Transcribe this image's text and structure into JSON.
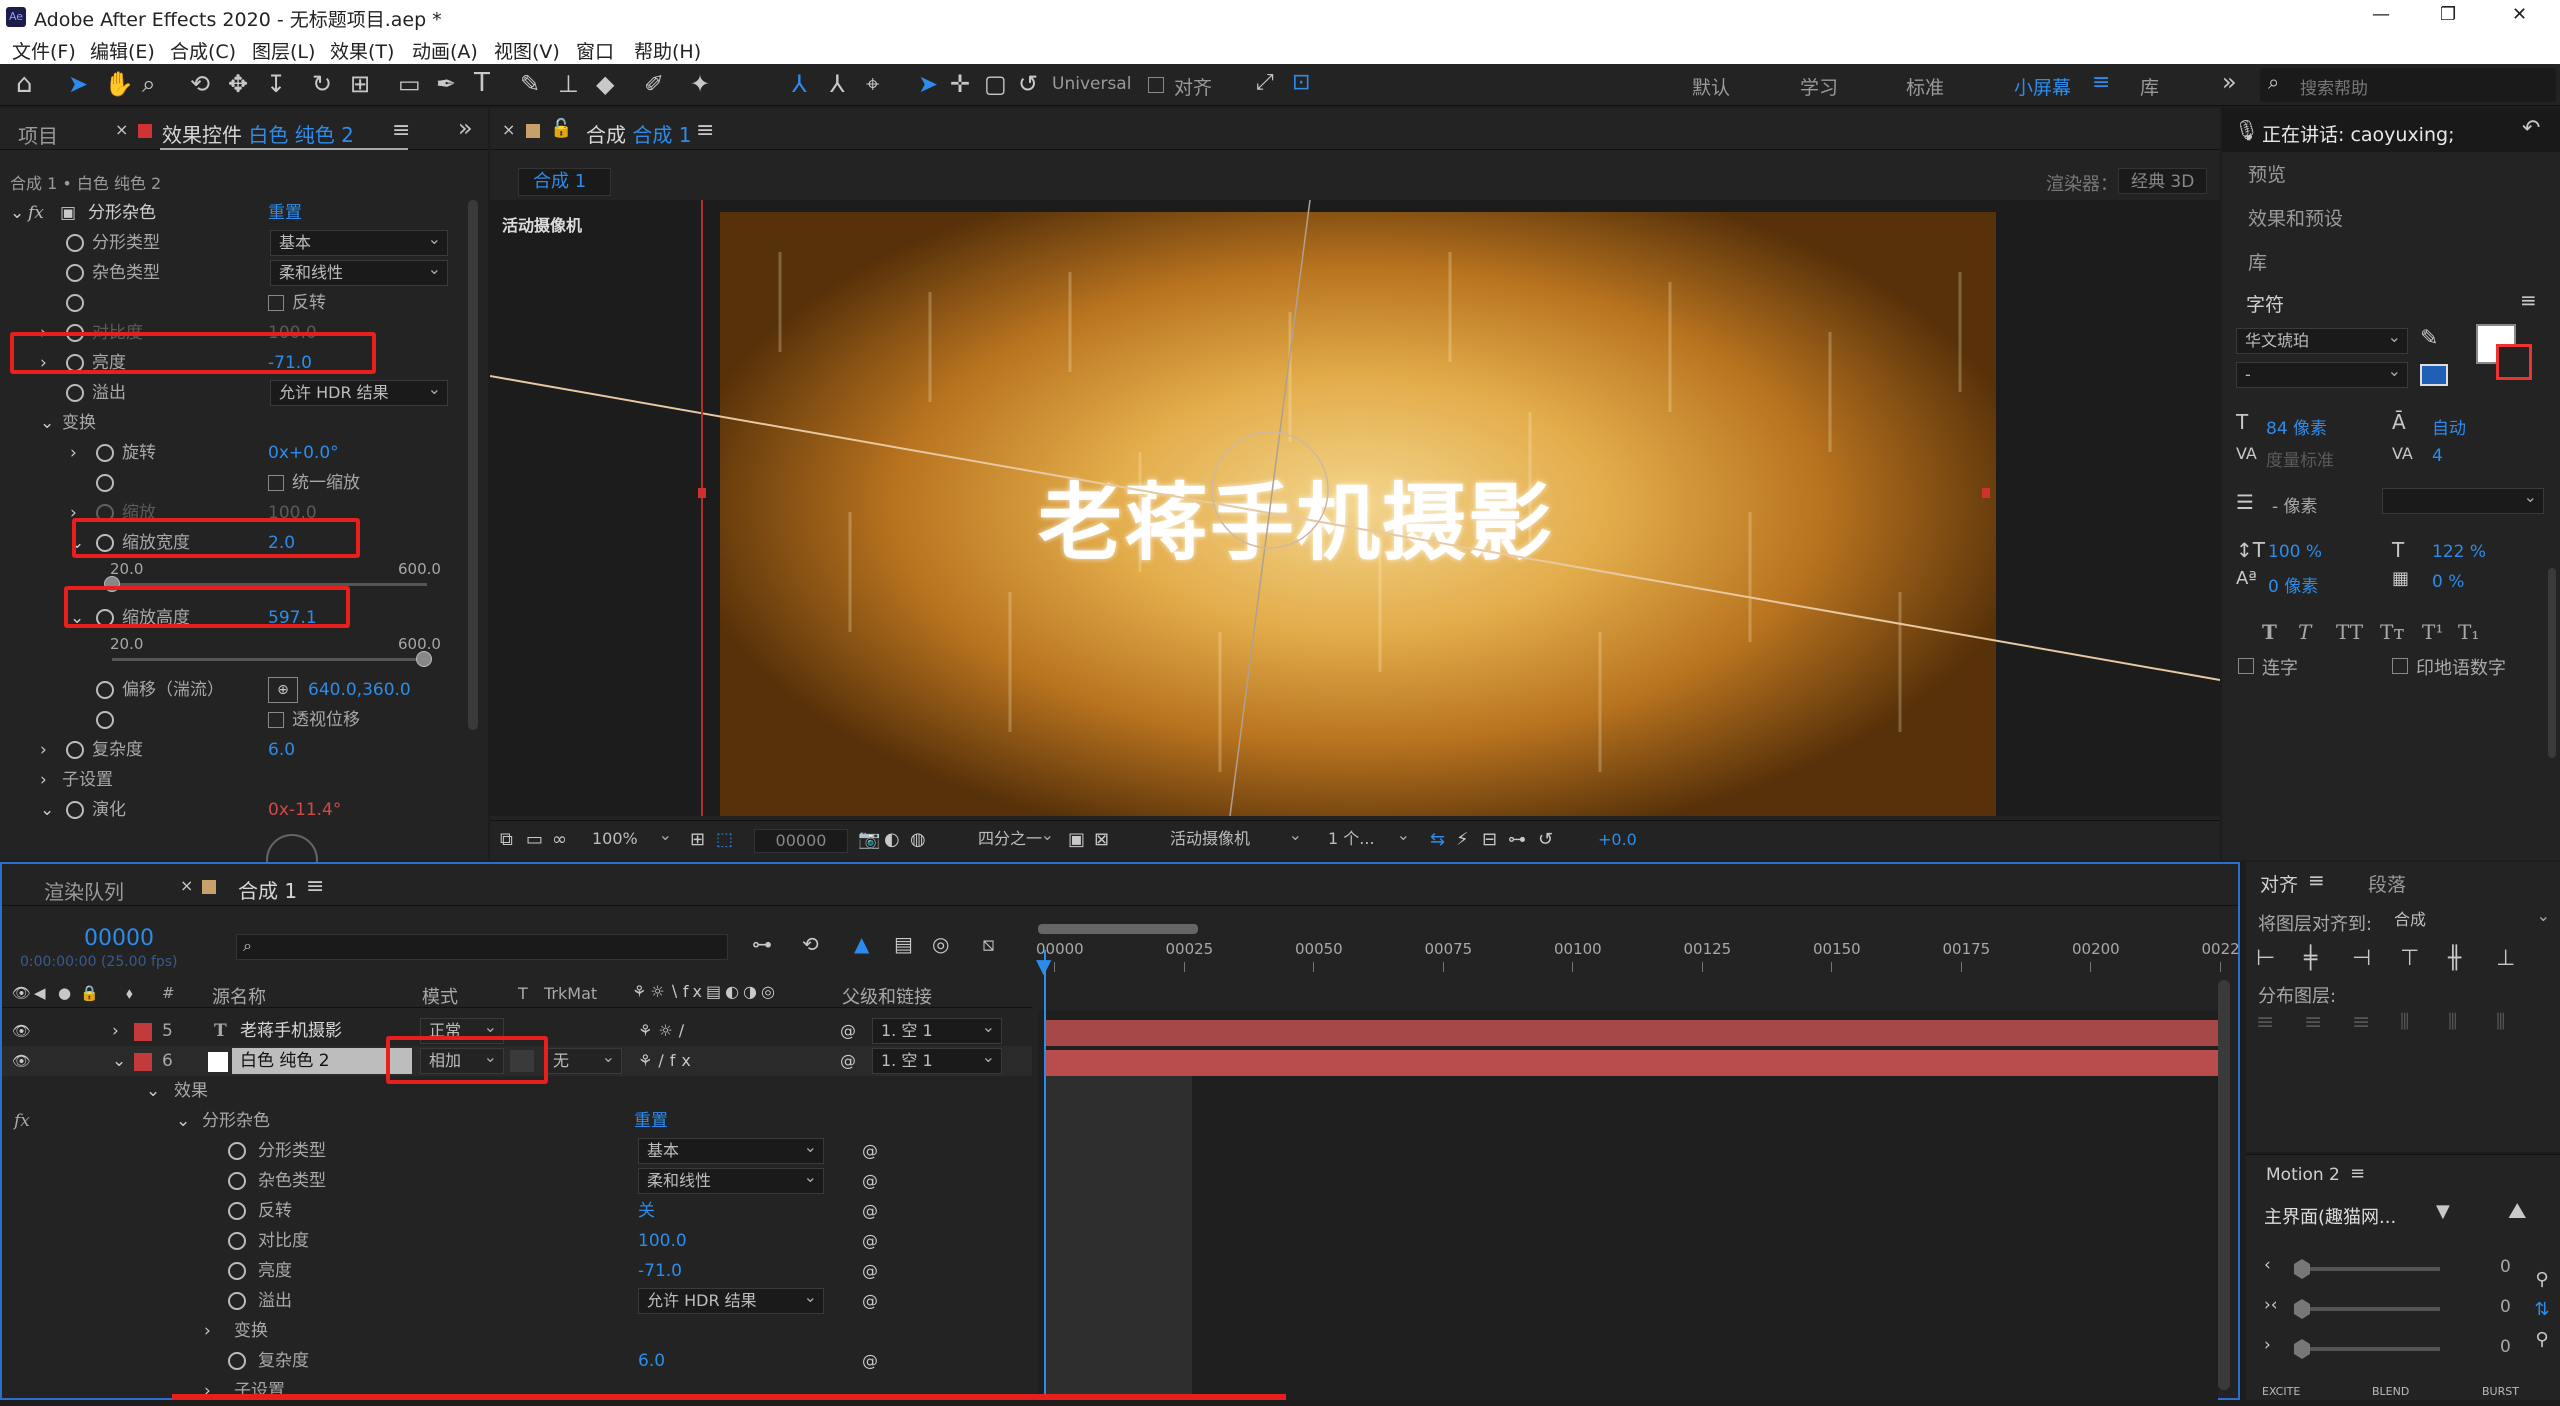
{
  "window": {
    "title": "Adobe After Effects 2020 - 无标题项目.aep *",
    "app_badge": "Ae",
    "min": "—",
    "max": "❐",
    "close": "✕"
  },
  "menu": [
    "文件(F)",
    "编辑(E)",
    "合成(C)",
    "图层(L)",
    "效果(T)",
    "动画(A)",
    "视图(V)",
    "窗口",
    "帮助(H)"
  ],
  "toolbar": {
    "universal": "Universal",
    "align_label": "对齐",
    "workspaces": [
      "默认",
      "学习",
      "标准",
      "小屏幕",
      "库"
    ],
    "active_workspace": "小屏幕",
    "search_placeholder": "搜索帮助"
  },
  "left_panel": {
    "tab_project": "项目",
    "tab_effects": "效果控件",
    "tab_effects_layer": "白色 纯色 2",
    "breadcrumb": "合成 1 • 白色 纯色 2",
    "effect_name": "分形杂色",
    "reset": "重置",
    "rows": [
      {
        "label": "分形类型",
        "value": "基本"
      },
      {
        "label": "杂色类型",
        "value": "柔和线性"
      },
      {
        "label": "",
        "value": "反转"
      },
      {
        "label": "对比度",
        "value": "100.0"
      },
      {
        "label": "亮度",
        "value": "-71.0"
      },
      {
        "label": "溢出",
        "value": "允许 HDR 结果"
      },
      {
        "label": "变换",
        "value": ""
      },
      {
        "label": "旋转",
        "value": "0x+0.0°"
      },
      {
        "label": "",
        "value": "统一缩放"
      },
      {
        "label": "缩放",
        "value": "100.0"
      },
      {
        "label": "缩放宽度",
        "value": "2.0"
      },
      {
        "label": "缩放高度",
        "value": "597.1"
      },
      {
        "label": "偏移（湍流）",
        "value": "640.0,360.0"
      },
      {
        "label": "",
        "value": "透视位移"
      },
      {
        "label": "复杂度",
        "value": "6.0"
      },
      {
        "label": "子设置",
        "value": ""
      },
      {
        "label": "演化",
        "value": "0x-11.4°"
      }
    ],
    "slider_min": "20.0",
    "slider_max": "600.0",
    "width_value": 0.0,
    "height_value": 0.99
  },
  "comp": {
    "tab": "合成",
    "tab_name": "合成 1",
    "subtab": "合成 1",
    "renderer_label": "渲染器：",
    "renderer": "经典 3D",
    "camera_label": "活动摄像机",
    "title_text": "老蒋手机摄影",
    "footer": {
      "zoom": "100%",
      "timecode": "00000",
      "quality": "四分之一",
      "camera": "活动摄像机",
      "views": "1 个...",
      "exposure": "+0.0"
    }
  },
  "right_panel": {
    "speaking": "正在讲话: caoyuxing;",
    "items": [
      "预览",
      "效果和预设",
      "库"
    ],
    "char_title": "字符",
    "font": "华文琥珀",
    "font_style": "-",
    "size": "84 像素",
    "leading": "自动",
    "kerning": "度量标准",
    "tracking": "4",
    "stroke": "- 像素",
    "vscale": "100 %",
    "hscale": "122 %",
    "baseline": "0 像素",
    "tsume": "0 %",
    "styles": [
      "T",
      "T",
      "TT",
      "Tт",
      "T¹",
      "T₁"
    ],
    "ligature": "连字",
    "hindi": "印地语数字",
    "align_tab": "对齐",
    "para_tab": "段落",
    "align_to_label": "将图层对齐到:",
    "align_to": "合成",
    "distribute": "分布图层:",
    "motion_title": "Motion 2",
    "motion_preset": "主界面(趣猫网...",
    "motion_vals": [
      "0",
      "0",
      "0"
    ],
    "motion_btns": [
      "EXCITE",
      "BLEND",
      "BURST"
    ]
  },
  "timeline": {
    "tab_render": "渲染队列",
    "tab_comp": "合成 1",
    "timecode": "00000",
    "fps": "0:00:00:00 (25.00 fps)",
    "cols": {
      "source": "源名称",
      "mode": "模式",
      "t": "T",
      "trkmat": "TrkMat",
      "parent": "父级和链接"
    },
    "ticks": [
      "00000",
      "00025",
      "00050",
      "00075",
      "00100",
      "00125",
      "00150",
      "00175",
      "00200",
      "0022"
    ],
    "layers": [
      {
        "num": "5",
        "name": "老蒋手机摄影",
        "mode": "正常",
        "parent": "1. 空 1"
      },
      {
        "num": "6",
        "name": "白色 纯色 2",
        "mode": "相加",
        "trk": "无",
        "parent": "1. 空 1"
      }
    ],
    "effects_label": "效果",
    "fx_name": "分形杂色",
    "fx_reset": "重置",
    "props": [
      {
        "label": "分形类型",
        "value": "基本"
      },
      {
        "label": "杂色类型",
        "value": "柔和线性"
      },
      {
        "label": "反转",
        "value": "关"
      },
      {
        "label": "对比度",
        "value": "100.0"
      },
      {
        "label": "亮度",
        "value": "-71.0"
      },
      {
        "label": "溢出",
        "value": "允许 HDR 结果"
      },
      {
        "label": "变换",
        "value": ""
      },
      {
        "label": "复杂度",
        "value": "6.0"
      },
      {
        "label": "子设置",
        "value": ""
      }
    ]
  }
}
